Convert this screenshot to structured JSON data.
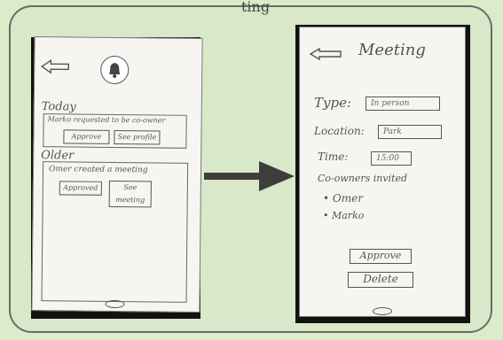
{
  "sketch_header": {
    "partial_title": "ting"
  },
  "left_screen": {
    "section_today": "Today",
    "notification_1": {
      "text": "Marko requested to be co-owner",
      "approve_label": "Approve",
      "see_profile_label": "See profile"
    },
    "section_older": "Older",
    "notification_2": {
      "text": "Omer created a meeting",
      "approved_label": "Approved",
      "see_meeting_label": "See meeting"
    }
  },
  "right_screen": {
    "title": "Meeting",
    "type_label": "Type:",
    "type_value": "In person",
    "location_label": "Location:",
    "location_value": "Park",
    "time_label": "Time:",
    "time_value": "15:00",
    "coowners_label": "Co-owners invited",
    "coowners": [
      "• Omer",
      "• Marko"
    ],
    "approve_label": "Approve",
    "delete_label": "Delete"
  },
  "icons": {
    "back": "back-arrow-icon",
    "bell": "bell-icon",
    "flow": "right-arrow-icon"
  }
}
